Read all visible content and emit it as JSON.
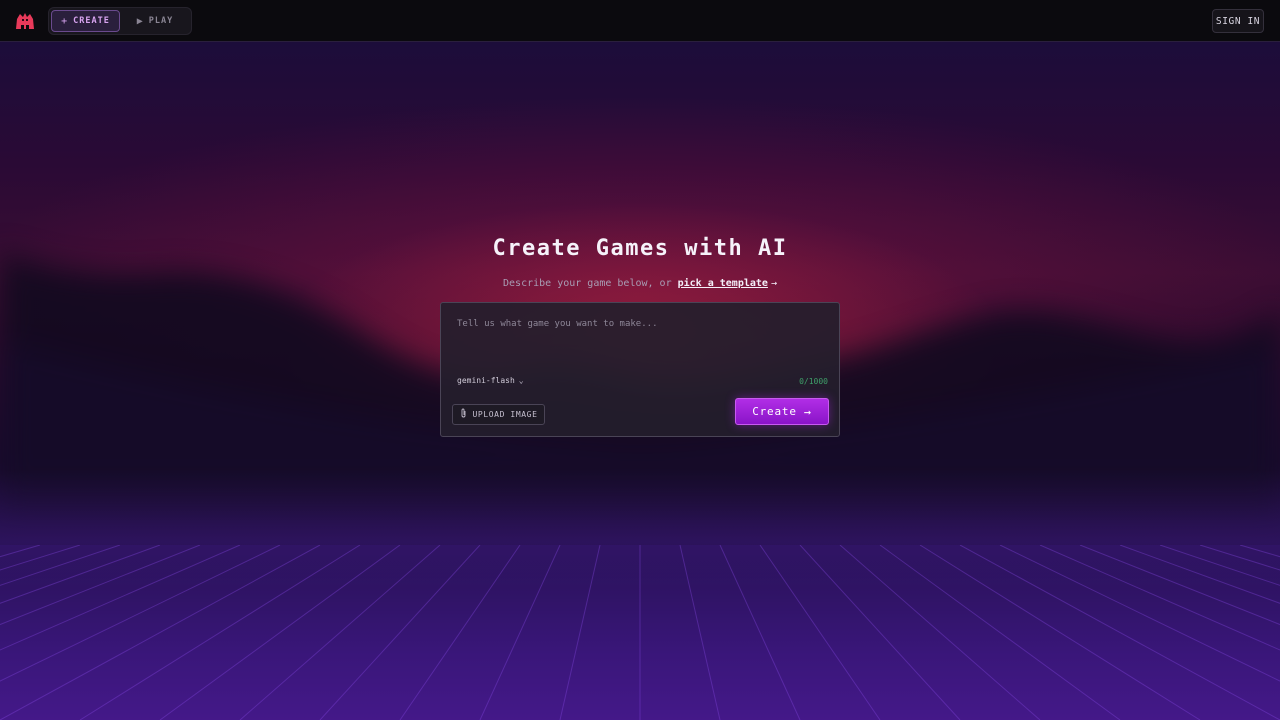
{
  "nav": {
    "create_label": "CREATE",
    "create_icon": "plus-icon",
    "play_label": "PLAY",
    "play_icon": "play-icon",
    "signin_label": "SIGN IN"
  },
  "hero": {
    "title": "Create Games with AI",
    "subtitle_prefix": "Describe your game below, or",
    "template_link": "pick a template",
    "link_arrow": "→"
  },
  "prompt": {
    "placeholder": "Tell us what game you want to make...",
    "value": "",
    "model": "gemini-flash",
    "counter": "0/1000",
    "upload_label": "UPLOAD IMAGE",
    "create_label": "Create",
    "create_arrow": "→"
  },
  "colors": {
    "accent": "#a020e0",
    "logo": "#e83a5a",
    "counter": "#3fa06a",
    "nav_active": "#d8a4f0"
  }
}
